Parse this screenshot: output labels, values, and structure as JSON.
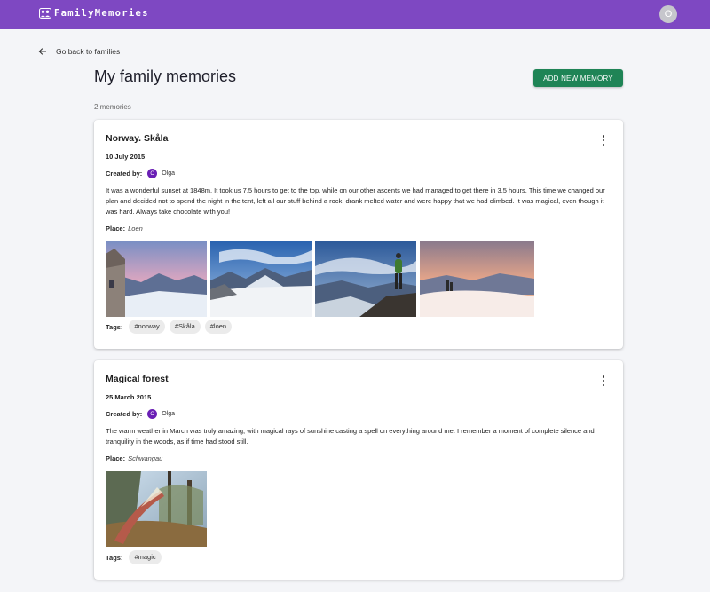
{
  "app": {
    "name": "FamilyMemories",
    "logo_icon": "family-icon",
    "user_initial": "O"
  },
  "nav": {
    "back_label": "Go back to families",
    "back_icon": "arrow-left-icon"
  },
  "page": {
    "title": "My family memories",
    "add_button": "ADD NEW MEMORY",
    "count_label": "2 memories"
  },
  "colors": {
    "header": "#7e48c2",
    "primary_button": "#1f8456",
    "avatar": "#6a1fb5"
  },
  "labels": {
    "created_by": "Created by:",
    "place": "Place:",
    "tags": "Tags:"
  },
  "memories": [
    {
      "title": "Norway. Skåla",
      "date": "10 July 2015",
      "creator": {
        "initial": "O",
        "name": "Olga"
      },
      "description": "It was a wonderful sunset at 1848m. It took us 7.5 hours to get to the top, while on our other ascents we had managed to get there in 3.5 hours. This time we changed our plan and decided not to spend the night in the tent, left all our stuff behind a rock, drank melted water and were happy that we had climbed. It was magical, even though it was hard. Always take chocolate with you!",
      "place": "Loen",
      "photos": [
        "hut-at-sunset-photo",
        "snowy-mountain-valley-photo",
        "hiker-on-ridge-photo",
        "summit-at-dusk-photo"
      ],
      "tags": [
        "#norway",
        "#Skåla",
        "#loen"
      ]
    },
    {
      "title": "Magical forest",
      "date": "25 March 2015",
      "creator": {
        "initial": "O",
        "name": "Olga"
      },
      "description": "The warm weather in March was truly amazing, with magical rays of sunshine casting a spell on everything around me. I remember a moment of complete silence and tranquility in the woods, as if time had stood still.",
      "place": "Schwangau",
      "photos": [
        "forest-sun-rays-photo"
      ],
      "tags": [
        "#magic"
      ]
    }
  ]
}
